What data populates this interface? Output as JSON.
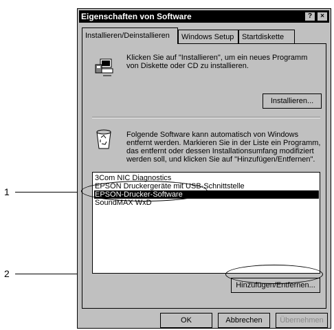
{
  "window": {
    "title": "Eigenschaften von Software",
    "help_button": "?",
    "close_button": "×"
  },
  "tabs": [
    {
      "label": "Installieren/Deinstallieren"
    },
    {
      "label": "Windows Setup"
    },
    {
      "label": "Startdiskette"
    }
  ],
  "install_section": {
    "icon": "install-program-icon",
    "text_line1": "Klicken Sie auf \"Installieren\", um ein neues Programm",
    "text_line2": "von Diskette oder CD zu installieren.",
    "install_button": "Installieren..."
  },
  "uninstall_section": {
    "icon": "recycle-bin-icon",
    "text_line1": "Folgende Software kann automatisch von Windows",
    "text_line2": "entfernt werden. Markieren Sie in der Liste ein Programm,",
    "text_line3": "das entfernt oder dessen Installationsumfang modifiziert",
    "text_line4": "werden soll, und klicken Sie auf \"Hinzufügen/Entfernen\"."
  },
  "program_list": [
    {
      "label": "3Com NIC Diagnostics"
    },
    {
      "label": "EPSON Druckergeräte mit USB-Schnittstelle"
    },
    {
      "label": "EPSON-Drucker-Software",
      "selected": true
    },
    {
      "label": "SoundMAX WxD"
    }
  ],
  "add_remove_button": "Hinzufügen/Entfernen...",
  "footer_buttons": {
    "ok": "OK",
    "cancel": "Abbrechen",
    "apply": "Übernehmen"
  },
  "callouts": [
    {
      "number": "1"
    },
    {
      "number": "2"
    }
  ]
}
